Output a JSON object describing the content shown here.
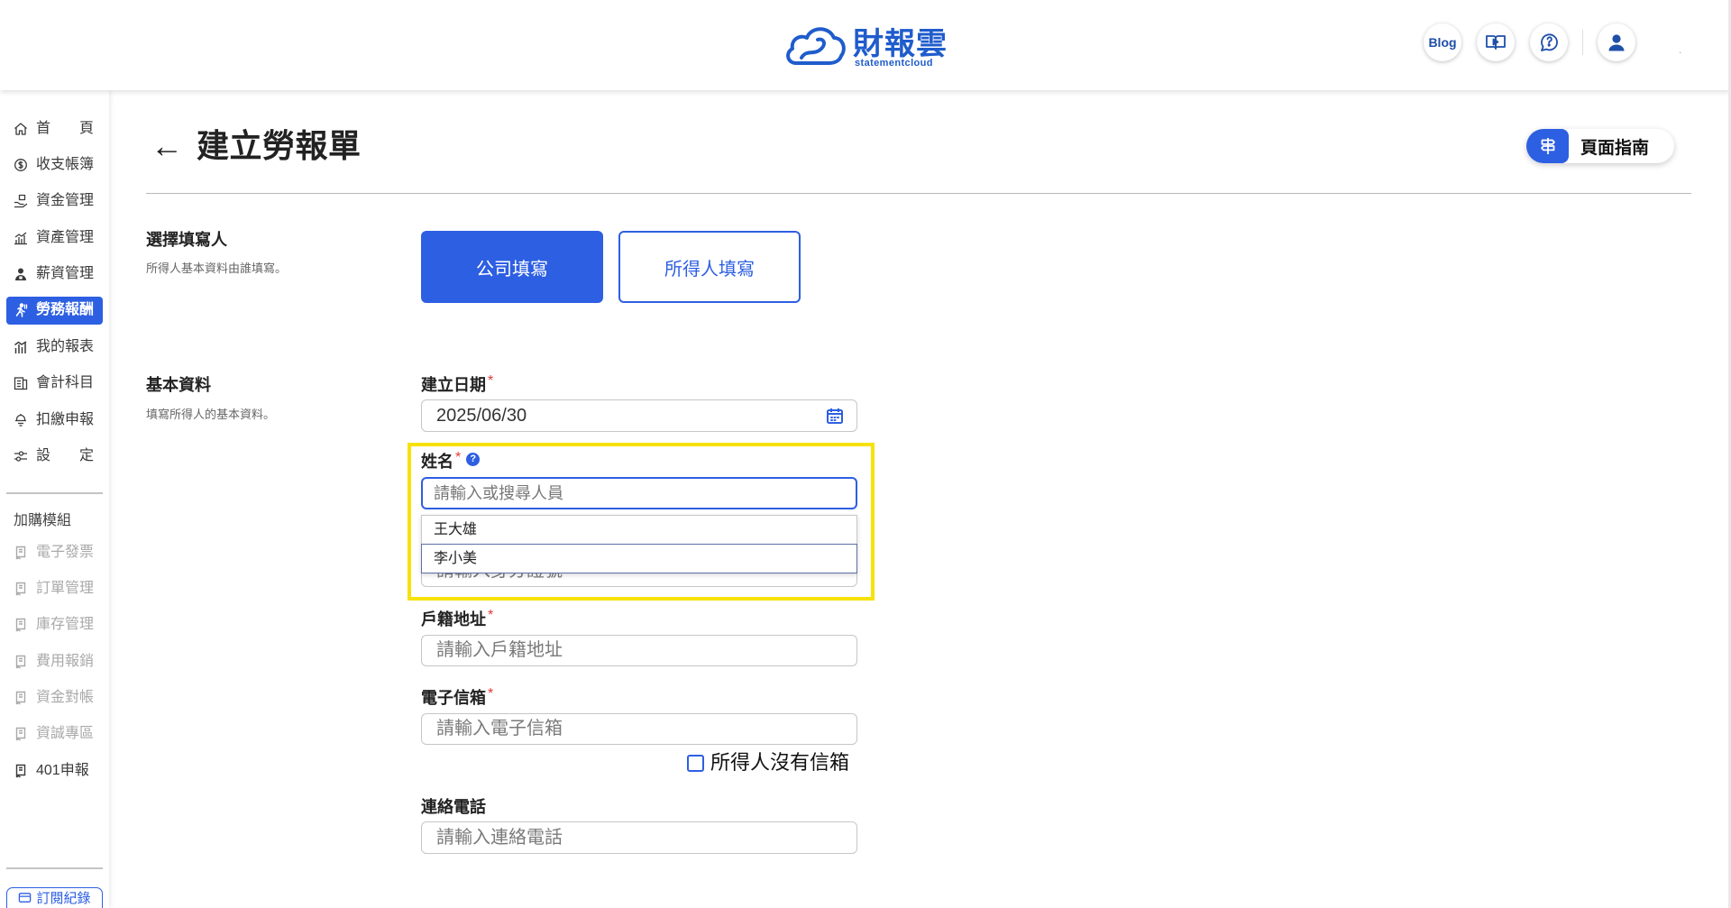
{
  "colors": {
    "primary": "#2d5fe2",
    "highlight": "#f7e10a",
    "required": "#e53935"
  },
  "header": {
    "logo_text": "財報雲",
    "logo_subtext": "statementcloud",
    "blog_label": "Blog",
    "icons": [
      "cloud-logo-icon",
      "video-guide-icon",
      "help-chat-icon",
      "user-icon"
    ],
    "trailing_dot": "."
  },
  "sidebar": {
    "items": [
      {
        "label": "首頁",
        "icon": "home-icon",
        "active": false
      },
      {
        "label": "收支帳簿",
        "icon": "coin-icon",
        "active": false
      },
      {
        "label": "資金管理",
        "icon": "fund-icon",
        "active": false
      },
      {
        "label": "資產管理",
        "icon": "assets-icon",
        "active": false
      },
      {
        "label": "薪資管理",
        "icon": "payroll-icon",
        "active": false
      },
      {
        "label": "勞務報酬",
        "icon": "labor-icon",
        "active": true
      },
      {
        "label": "我的報表",
        "icon": "report-icon",
        "active": false
      },
      {
        "label": "會計科目",
        "icon": "ledger-icon",
        "active": false
      },
      {
        "label": "扣繳申報",
        "icon": "withholding-icon",
        "active": false
      },
      {
        "label": "設定",
        "icon": "settings-icon",
        "active": false
      }
    ],
    "addon_title": "加購模組",
    "addons": [
      {
        "label": "電子發票",
        "enabled": false
      },
      {
        "label": "訂單管理",
        "enabled": false
      },
      {
        "label": "庫存管理",
        "enabled": false
      },
      {
        "label": "費用報銷",
        "enabled": false
      },
      {
        "label": "資金對帳",
        "enabled": false
      },
      {
        "label": "資誠專區",
        "enabled": false
      },
      {
        "label": "401申報",
        "enabled": true
      }
    ],
    "subscription_label": "訂閱紀錄"
  },
  "page": {
    "back_arrow": "←",
    "title": "建立勞報單",
    "guide_label": "頁面指南"
  },
  "filler_section": {
    "title": "選擇填寫人",
    "desc": "所得人基本資料由誰填寫。",
    "options": [
      {
        "label": "公司填寫",
        "selected": true
      },
      {
        "label": "所得人填寫",
        "selected": false
      }
    ]
  },
  "basic_section": {
    "title": "基本資料",
    "desc": "填寫所得人的基本資料。"
  },
  "required_mark": "*",
  "form": {
    "date": {
      "label": "建立日期",
      "required": true,
      "value": "2025/06/30"
    },
    "name": {
      "label": "姓名",
      "required": true,
      "help_glyph": "?",
      "placeholder": "請輸入或搜尋人員",
      "suggestions": [
        "王大雄",
        "李小美"
      ]
    },
    "id_number": {
      "placeholder": "請輸入身分證號"
    },
    "address": {
      "label": "戶籍地址",
      "required": true,
      "placeholder": "請輸入戶籍地址"
    },
    "email": {
      "label": "電子信箱",
      "required": true,
      "placeholder": "請輸入電子信箱",
      "no_email_label": "所得人沒有信箱",
      "no_email_checked": false
    },
    "phone": {
      "label": "連絡電話",
      "required": false,
      "placeholder": "請輸入連絡電話"
    }
  }
}
